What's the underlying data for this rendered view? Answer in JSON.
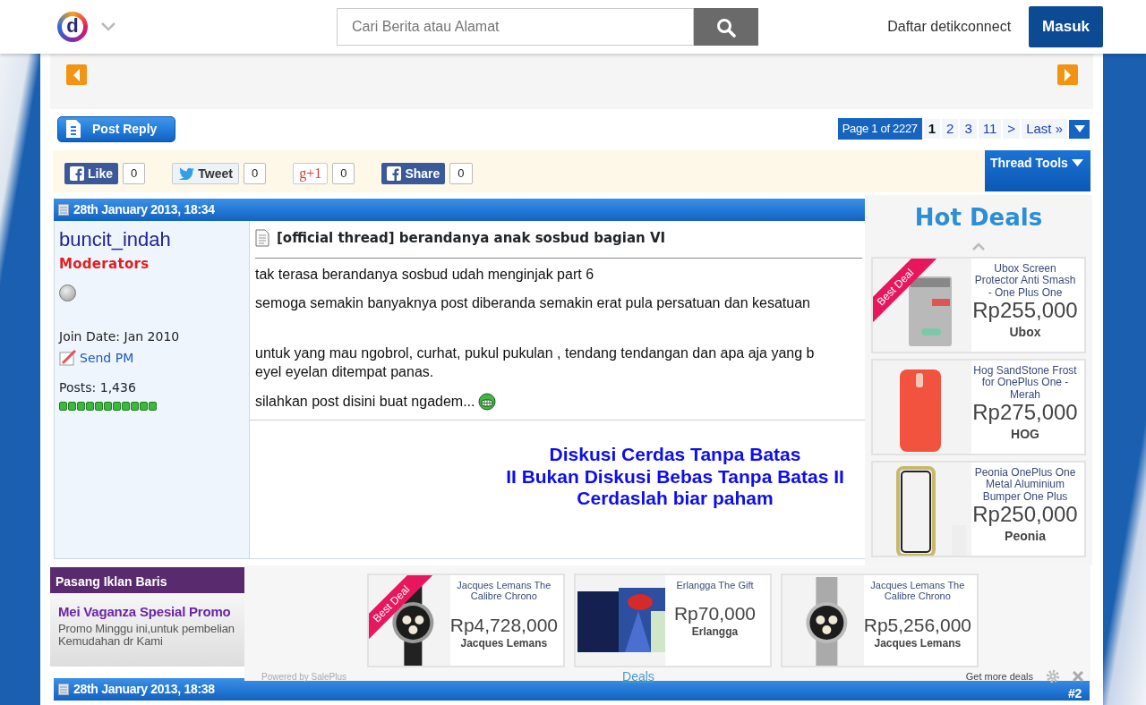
{
  "header": {
    "logo_letter": "d",
    "search": {
      "placeholder": "Cari Berita atau Alamat"
    },
    "register_link": "Daftar detikconnect",
    "login_button": "Masuk"
  },
  "toolbar": {
    "post_reply": "Post Reply",
    "pagination": {
      "label": "Page 1 of 2227",
      "pages": [
        {
          "label": "1",
          "selected": true
        },
        {
          "label": "2",
          "selected": false
        },
        {
          "label": "3",
          "selected": false
        },
        {
          "label": "11",
          "selected": false
        },
        {
          "label": ">",
          "selected": false
        },
        {
          "label": "Last »",
          "selected": false
        }
      ]
    }
  },
  "social": {
    "buttons": [
      {
        "kind": "facebook",
        "label": "Like",
        "count": "0"
      },
      {
        "kind": "twitter",
        "label": "Tweet",
        "count": "0"
      },
      {
        "kind": "gplus",
        "label": "g+1",
        "count": "0"
      },
      {
        "kind": "facebook",
        "label": "Share",
        "count": "0"
      }
    ],
    "thread_tools": "Thread Tools"
  },
  "posts": [
    {
      "date": "28th January 2013, 18:34",
      "user": {
        "name": "buncit_indah",
        "rank": "Moderators",
        "online": false,
        "join_date": "Join Date: Jan 2010",
        "send_pm": "Send PM",
        "posts": "Posts: 1,436"
      },
      "title": "[official thread] berandanya anak sosbud bagian VI",
      "paragraphs": [
        {
          "text": "tak terasa berandanya sosbud udah menginjak part 6"
        },
        {
          "text": "semoga semakin banyaknya post diberanda semakin erat pula persatuan dan kesatuan"
        },
        {
          "text": "untuk yang mau ngobrol, curhat, pukul pukulan , tendang tendangan dan apa aja yang b\neyel eyelan ditempat panas."
        },
        {
          "text": "silahkan post disini buat ngadem..."
        }
      ],
      "signature": "Diskusi Cerdas Tanpa Batas\nII Bukan Diskusi Bebas Tanpa Batas II\nCerdaslah biar paham"
    },
    {
      "date": "28th January 2013, 18:38",
      "number": "#2"
    }
  ],
  "hot_deals": {
    "title": "Hot Deals",
    "items": [
      {
        "name": "Ubox Screen Protector Anti Smash - One Plus One",
        "price": "Rp255,000",
        "brand": "Ubox",
        "ribbon": "Best Deal"
      },
      {
        "name": "Hog SandStone Frost for OnePlus One - Merah",
        "price": "Rp275,000",
        "brand": "HOG"
      },
      {
        "name": "Peonia OnePlus One Metal Aluminium Bumper One Plus",
        "price": "Rp250,000",
        "brand": "Peonia"
      }
    ]
  },
  "classified": {
    "title": "Pasang Iklan Baris",
    "headline": "Mei Vaganza Spesial Promo",
    "text": "Promo Minggu ini,untuk pembelian\nKemudahan dr Kami"
  },
  "deals_bar": {
    "items": [
      {
        "name": "Jacques Lemans The Calibre Chrono",
        "price": "Rp4,728,000",
        "brand": "Jacques Lemans",
        "ribbon": "Best Deal"
      },
      {
        "name": "Erlangga The Gift",
        "price": "Rp70,000",
        "brand": "Erlangga"
      },
      {
        "name": "Jacques Lemans The Calibre Chrono",
        "price": "Rp5,256,000",
        "brand": "Jacques Lemans"
      }
    ],
    "powered_by": "Powered by SalePlus",
    "tab": "Deals",
    "more_link": "Get more deals"
  }
}
